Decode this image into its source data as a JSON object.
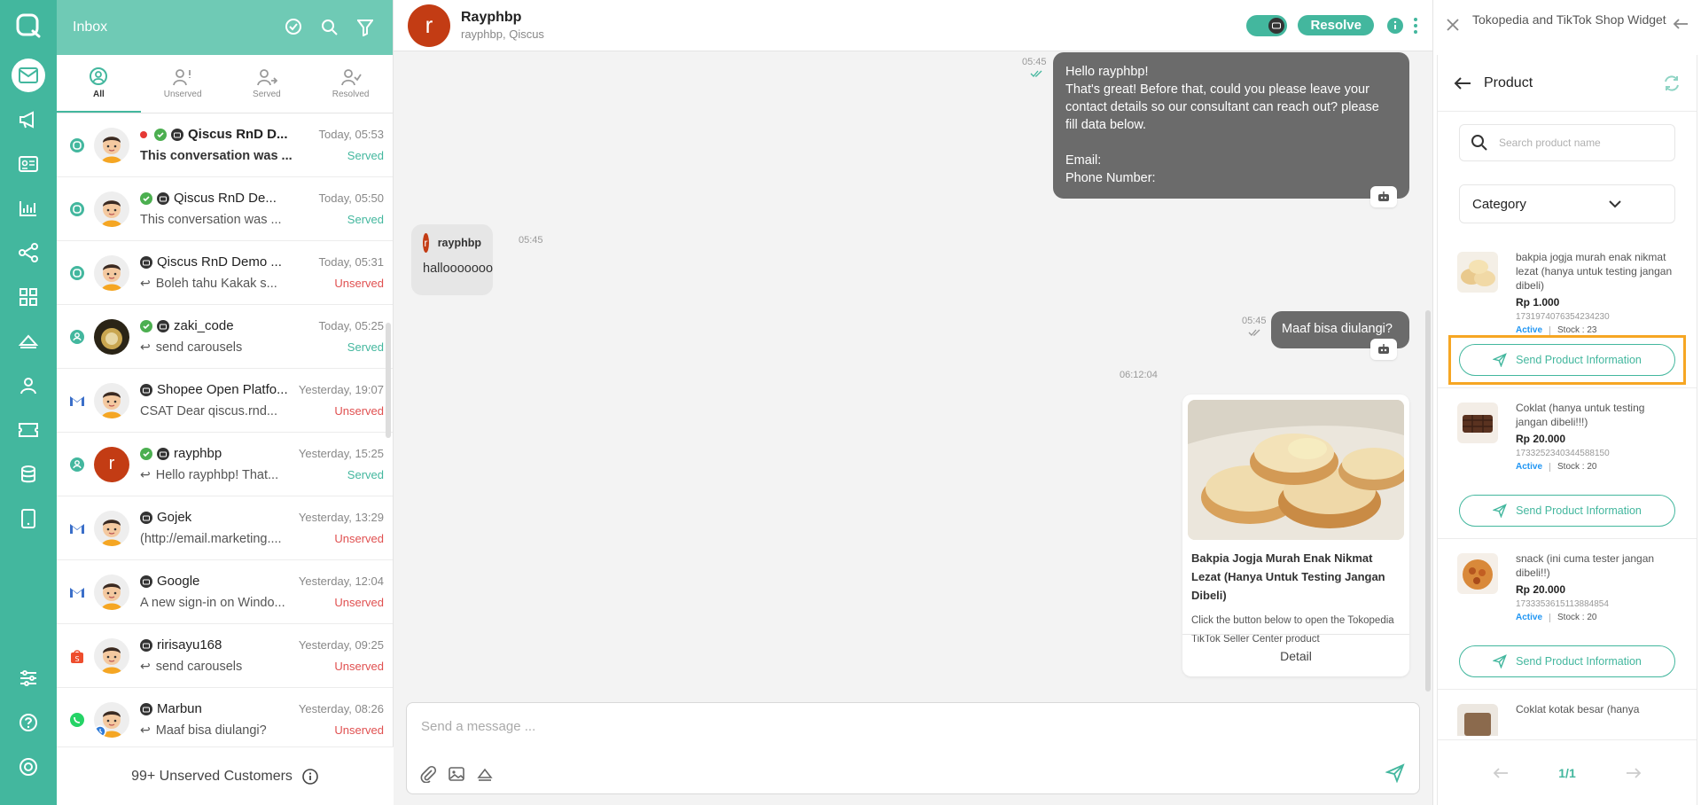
{
  "colors": {
    "brand": "#43b79e",
    "inbox_header": "#6fcab5",
    "served": "#43b79e",
    "unserved": "#e05050",
    "highlight": "#f6a623"
  },
  "inbox": {
    "title": "Inbox",
    "tabs": [
      {
        "label": "All"
      },
      {
        "label": "Unserved"
      },
      {
        "label": "Served"
      },
      {
        "label": "Resolved"
      }
    ],
    "conversations": [
      {
        "name": "Qiscus RnD D...",
        "time": "Today, 05:53",
        "message": "This conversation was ...",
        "status": "Served"
      },
      {
        "name": "Qiscus RnD De...",
        "time": "Today, 05:50",
        "message": "This conversation was ...",
        "status": "Served"
      },
      {
        "name": "Qiscus RnD Demo ...",
        "time": "Today, 05:31",
        "message": "Boleh tahu Kakak s...",
        "status": "Unserved"
      },
      {
        "name": "zaki_code",
        "time": "Today, 05:25",
        "message": "send carousels",
        "status": "Served"
      },
      {
        "name": "Shopee Open Platfo...",
        "time": "Yesterday, 19:07",
        "message": "CSAT Dear qiscus.rnd...",
        "status": "Unserved"
      },
      {
        "name": "rayphbp",
        "time": "Yesterday, 15:25",
        "message": "Hello rayphbp! That...",
        "status": "Served",
        "avatar_letter": "r"
      },
      {
        "name": "Gojek",
        "time": "Yesterday, 13:29",
        "message": "(http://email.marketing....",
        "status": "Unserved"
      },
      {
        "name": "Google",
        "time": "Yesterday, 12:04",
        "message": "A new sign-in on Windo...",
        "status": "Unserved"
      },
      {
        "name": "ririsayu168",
        "time": "Yesterday, 09:25",
        "message": "send carousels",
        "status": "Unserved"
      },
      {
        "name": "Marbun",
        "time": "Yesterday, 08:26",
        "message": "Maaf bisa diulangi?",
        "status": "Unserved"
      }
    ],
    "unserved_footer": "99+ Unserved Customers"
  },
  "chat": {
    "avatar_letter": "r",
    "name": "Rayphbp",
    "subtitle": "rayphbp, Qiscus",
    "resolve_label": "Resolve",
    "messages": {
      "m1": {
        "time": "05:45",
        "lines": [
          "Hello rayphbp!",
          "That's great! Before that, could you please leave your",
          "contact details so our consultant can reach out? please",
          "fill data below.",
          "",
          "Email:",
          "Phone Number:"
        ]
      },
      "m2": {
        "sender_letter": "r",
        "sender": "rayphbp",
        "time": "05:45",
        "text": "hallooooooo"
      },
      "m3": {
        "time": "05:45",
        "text": "Maaf bisa diulangi?"
      },
      "m4_time": "06:12:04",
      "card": {
        "title": "Bakpia Jogja Murah Enak Nikmat Lezat (Hanya Untuk Testing Jangan Dibeli)",
        "description": "Click the button below to open the Tokopedia TikTok Seller Center product",
        "button": "Detail"
      }
    },
    "composer_placeholder": "Send a message ..."
  },
  "widget": {
    "title": "Tokopedia and TikTok Shop Widget",
    "panel_title": "Product",
    "search_placeholder": "Search product name",
    "category_label": "Category",
    "products": [
      {
        "name": "bakpia jogja murah enak nikmat lezat (hanya untuk testing jangan dibeli)",
        "price": "Rp 1.000",
        "sku": "1731974076354234230",
        "status": "Active",
        "stock": "Stock : 23",
        "button": "Send Product Information"
      },
      {
        "name": "Coklat (hanya untuk testing jangan dibeli!!!)",
        "price": "Rp 20.000",
        "sku": "1733252340344588150",
        "status": "Active",
        "stock": "Stock : 20",
        "button": "Send Product Information"
      },
      {
        "name": "snack (ini cuma tester jangan dibeli!!)",
        "price": "Rp 20.000",
        "sku": "1733353615113884854",
        "status": "Active",
        "stock": "Stock : 20",
        "button": "Send Product Information"
      },
      {
        "name": "Coklat kotak besar (hanya"
      }
    ],
    "page_indicator": "1/1"
  }
}
